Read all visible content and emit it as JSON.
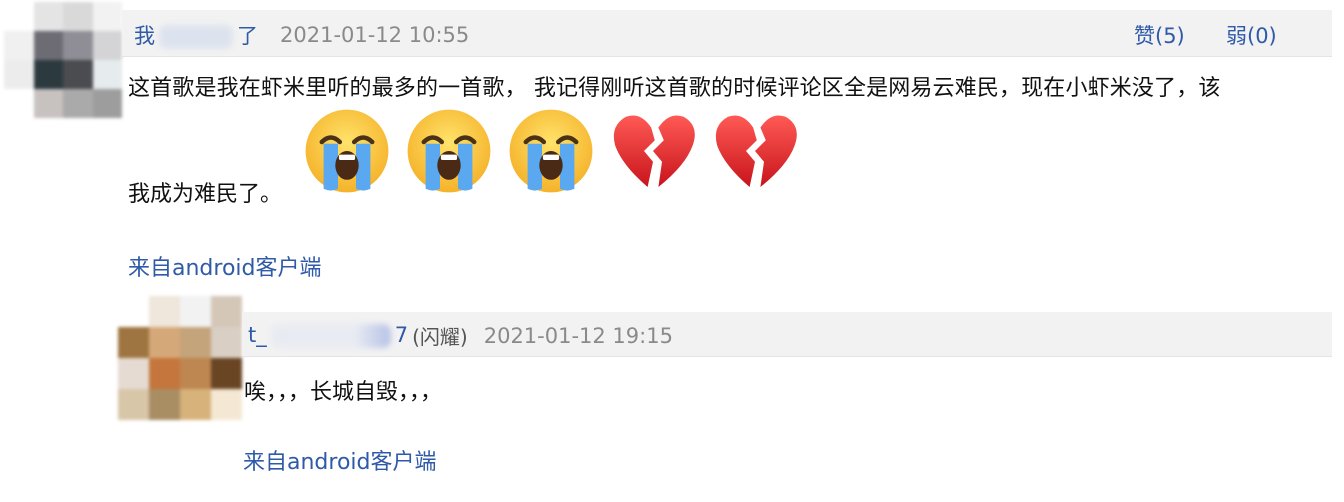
{
  "comments": [
    {
      "username_prefix": "我",
      "username_suffix": "了",
      "timestamp": "2021-01-12 10:55",
      "like_label": "赞(5)",
      "weak_label": "弱(0)",
      "text_line1": "这首歌是我在虾米里听的最多的一首歌， 我记得刚听这首歌的时候评论区全是网易云难民，现在小虾米没了，该",
      "text_line2": "我成为难民了。",
      "emojis": [
        "loudly-crying-face",
        "loudly-crying-face",
        "loudly-crying-face",
        "broken-heart",
        "broken-heart"
      ],
      "source": "来自android客户端"
    },
    {
      "username_prefix": "t_",
      "username_suffix": "7",
      "flair": "(闪耀)",
      "timestamp": "2021-01-12 19:15",
      "text": "唉，，，长城自毁，，，",
      "source": "来自android客户端"
    }
  ],
  "colors": {
    "link": "#2f5aa8",
    "header_bg": "#f2f2f2",
    "time": "#8a8a8a"
  },
  "avatar_palettes": {
    "avatar1": [
      "#ffffff",
      "#e4e4e4",
      "#d9d9d9",
      "#f2f2f2",
      "#f0f0f0",
      "#6d6c74",
      "#8f8e96",
      "#d4d4d6",
      "#ececec",
      "#2c3a40",
      "#4a4c50",
      "#e6ebee",
      "#ffffff",
      "#c7c1c0",
      "#aaaaaa",
      "#9d9d9d"
    ],
    "avatar2": [
      "#ffffff",
      "#efe6dc",
      "#f2f2f2",
      "#d4c7b8",
      "#9e7540",
      "#d5a879",
      "#c4a47b",
      "#d9cfc4",
      "#e5dbd2",
      "#c4763c",
      "#be8650",
      "#6a4524",
      "#d8c6a8",
      "#a98d63",
      "#d7b27a",
      "#f4e8d4"
    ]
  }
}
